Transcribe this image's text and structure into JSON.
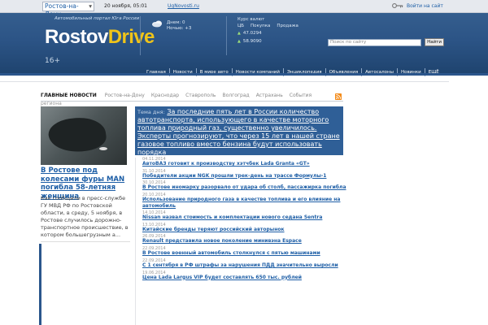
{
  "topbar": {
    "city": "Ростов-на-Дону",
    "datetime": "20 ноября, 05:01",
    "link": "UgNovosti.ru",
    "login": "Войти на сайт"
  },
  "header": {
    "slogan": "Автомобильный портал Юга России",
    "logo_left": "Rostov",
    "logo_right": "Drive",
    "age": "16+",
    "weather_day": "Днем: 0",
    "weather_night": "Ночью: +3",
    "rates": {
      "title": "Курс валют",
      "col_cb": "ЦБ",
      "col_buy": "Покупка",
      "col_sell": "Продажа",
      "usd": "47.0294",
      "eur": "58.9090"
    },
    "search_placeholder": "Поиск по сайту",
    "search_button": "Найти"
  },
  "nav": [
    "Главная",
    "Новости",
    "В мире авто",
    "Новости компаний",
    "Энциклопедия",
    "Объявления",
    "Автосалоны",
    "Новинки",
    "ЕЩЁ"
  ],
  "tabs": {
    "main": "ГЛАВНЫЕ НОВОСТИ",
    "items": [
      "Ростов-на-Дону",
      "Краснодар",
      "Ставрополь",
      "Волгоград",
      "Астрахань",
      "События"
    ],
    "region": "региона"
  },
  "featured": {
    "title": "В Ростове под колесами фуры MAN погибла 58-летняя женщина",
    "desc": "Как сообщили в пресс-службе ГУ МВД РФ по Ростовской области, в среду, 5 ноября, в Ростове случилось дорожно-транспортное происшествие, в котором большегрузным а..."
  },
  "tema": {
    "label": "Тема дня:",
    "text": "За последние пять лет в России количество автотранспорта, использующего в качестве моторного топлива природный газ, существенно увеличилось. Эксперты прогнозируют, что через 15 лет в нашей стране газовое топливо вместо бензина будут использовать порядка"
  },
  "news": [
    {
      "date": "04.11.2014",
      "title": "АвтоВАЗ готовит к производству хэтчбек Lada Granta «GT»"
    },
    {
      "date": "31.10.2014",
      "title": "Победители акции NGK прошли трек-день на трассе Формулы-1"
    },
    {
      "date": "30.10.2014",
      "title": "В Ростове иномарку разорвало от удара об столб, пассажирка погибла"
    },
    {
      "date": "20.10.2014",
      "title": "Использование природного газа в качестве топлива и его влияние на автомобиль"
    },
    {
      "date": "14.10.2014",
      "title": "Nissan назвал стоимость и комплектации нового седана Sentra"
    },
    {
      "date": "13.10.2014",
      "title": "Китайские бренды теряют российский авторынок"
    },
    {
      "date": "26.09.2014",
      "title": "Renault представила новое поколение минивэна Espace"
    },
    {
      "date": "22.09.2014",
      "title": "В Ростове военный автомобиль столкнулся с пятью машинами"
    },
    {
      "date": "22.09.2014",
      "title": "С 1 сентября в РФ штрафы за нарушения ПДД значительно выросли"
    },
    {
      "date": "19.06.2014",
      "title": "Цена Lada Largus VIP будет составлять 650 тыс. рублей"
    }
  ]
}
